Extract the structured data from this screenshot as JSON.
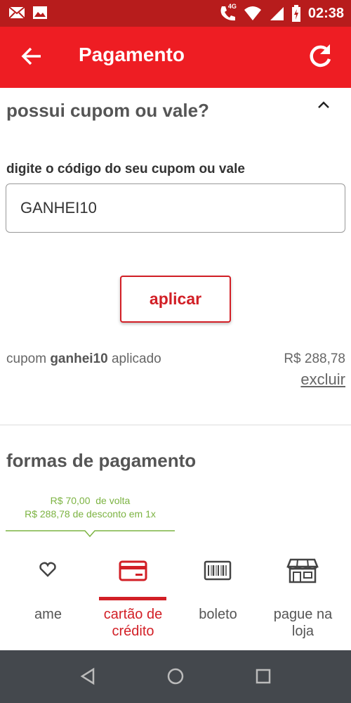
{
  "status_bar": {
    "time": "02:38",
    "network": "4G",
    "icons": [
      "mail-icon",
      "image-icon",
      "call-icon",
      "wifi-icon",
      "signal-icon",
      "battery-icon"
    ]
  },
  "app_bar": {
    "title": "Pagamento",
    "back_icon": "arrow-left-icon",
    "refresh_icon": "refresh-icon",
    "color": "#ee1d23"
  },
  "coupon": {
    "title": "possui cupom ou vale?",
    "input_label": "digite o código do seu cupom ou vale",
    "input_value": "GANHEI10",
    "apply_label": "aplicar",
    "applied_prefix": "cupom",
    "applied_code": "ganhei10",
    "applied_suffix": "aplicado",
    "applied_value": "R$ 288,78",
    "remove_label": "excluir"
  },
  "payment": {
    "title": "formas de pagamento",
    "cashback_line1": "R$ 70,00  de volta",
    "cashback_line2": "R$ 288,78 de desconto em 1x",
    "cashback_color": "#7cb342",
    "methods": [
      {
        "label": "ame",
        "icon": "ame-heart-icon",
        "active": false
      },
      {
        "label": "cartão de crédito",
        "icon": "credit-card-icon",
        "active": true
      },
      {
        "label": "boleto",
        "icon": "barcode-icon",
        "active": false
      },
      {
        "label": "pague na loja",
        "icon": "store-icon",
        "active": false
      }
    ],
    "accent": "#d21f26"
  },
  "nav_bar": {
    "buttons": [
      "back-triangle-icon",
      "home-circle-icon",
      "recents-square-icon"
    ]
  }
}
